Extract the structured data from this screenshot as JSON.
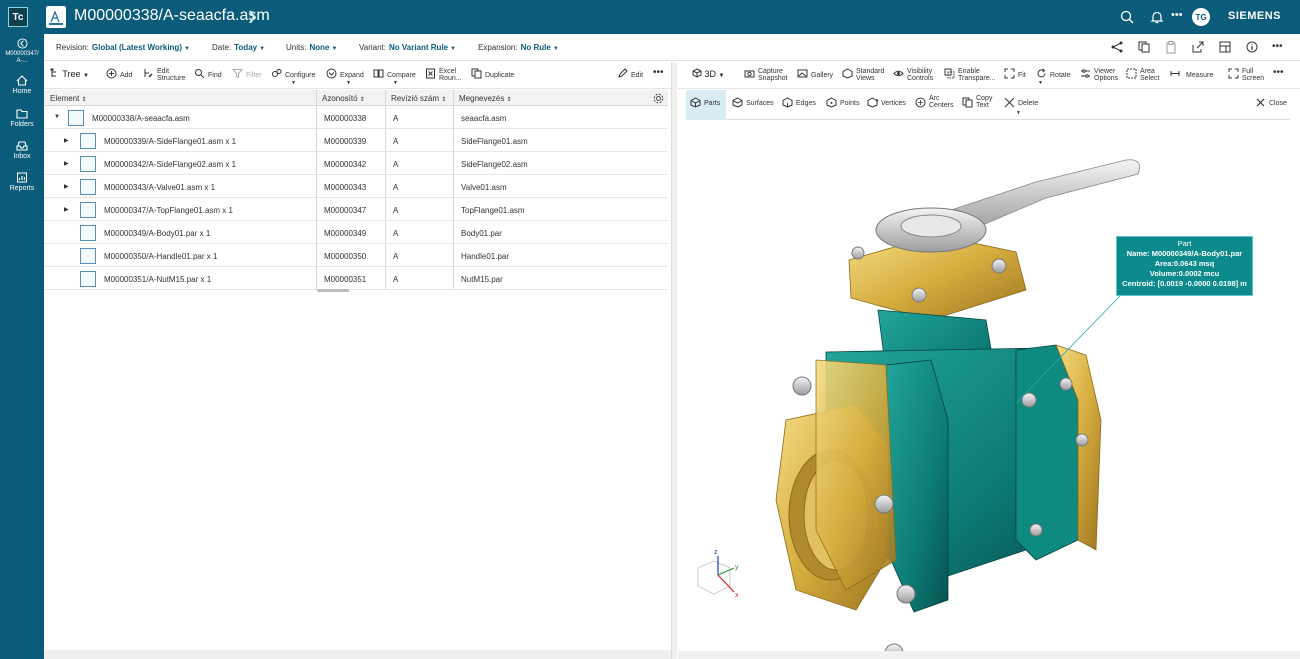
{
  "app": {
    "logo": "Tc",
    "title": "M00000338/A-seaacfa.asm",
    "brand": "SIEMENS",
    "user_initials": "TG"
  },
  "rail": {
    "items": [
      {
        "label": "M00000347/\nA-...",
        "icon": "back-icon"
      },
      {
        "label": "Home",
        "icon": "home-icon"
      },
      {
        "label": "Folders",
        "icon": "folder-icon"
      },
      {
        "label": "Inbox",
        "icon": "inbox-icon"
      },
      {
        "label": "Reports",
        "icon": "reports-icon"
      }
    ]
  },
  "context": {
    "revision_label": "Revision:",
    "revision_value": "Global (Latest Working)",
    "date_label": "Date:",
    "date_value": "Today",
    "units_label": "Units:",
    "units_value": "None",
    "variant_label": "Variant:",
    "variant_value": "No Variant Rule",
    "expansion_label": "Expansion:",
    "expansion_value": "No Rule"
  },
  "left_toolbar": {
    "tree": "Tree",
    "add": "Add",
    "edit_structure_1": "Edit",
    "edit_structure_2": "Structure",
    "find": "Find",
    "filter": "Filter",
    "configure": "Configure",
    "expand": "Expand",
    "compare": "Compare",
    "excel_1": "Excel",
    "excel_2": "Roun...",
    "duplicate": "Duplicate",
    "edit": "Edit",
    "more": "•••"
  },
  "table": {
    "headers": [
      "Element",
      "Azonosító",
      "Revízió szám",
      "Megnevezés"
    ],
    "rows": [
      {
        "element": "M00000338/A-seaacfa.asm",
        "id": "M00000338",
        "rev": "A",
        "name": "seaacfa.asm"
      },
      {
        "element": "M00000339/A-SideFlange01.asm x 1",
        "id": "M00000339",
        "rev": "A",
        "name": "SideFlange01.asm"
      },
      {
        "element": "M00000342/A-SideFlange02.asm x 1",
        "id": "M00000342",
        "rev": "A",
        "name": "SideFlange02.asm"
      },
      {
        "element": "M00000343/A-Valve01.asm x 1",
        "id": "M00000343",
        "rev": "A",
        "name": "Valve01.asm"
      },
      {
        "element": "M00000347/A-TopFlange01.asm x 1",
        "id": "M00000347",
        "rev": "A",
        "name": "TopFlange01.asm"
      },
      {
        "element": "M00000349/A-Body01.par x 1",
        "id": "M00000349",
        "rev": "A",
        "name": "Body01.par"
      },
      {
        "element": "M00000350/A-Handle01.par x 1",
        "id": "M00000350",
        "rev": "A",
        "name": "Handle01.par"
      },
      {
        "element": "M00000351/A-NutM15.par x 1",
        "id": "M00000351",
        "rev": "A",
        "name": "NutM15.par"
      }
    ]
  },
  "viewer_toolbar": {
    "mode": "3D",
    "capture_1": "Capture",
    "capture_2": "Snapshot",
    "gallery": "Gallery",
    "standard_1": "Standard",
    "standard_2": "Views",
    "visibility_1": "Visibility",
    "visibility_2": "Controls",
    "enable_1": "Enable",
    "enable_2": "Transpare...",
    "fit": "Fit",
    "rotate": "Rotate",
    "viewer_1": "Viewer",
    "viewer_2": "Options",
    "area_1": "Area",
    "area_2": "Select",
    "measure": "Measure",
    "full_1": "Full",
    "full_2": "Screen",
    "more": "•••"
  },
  "measure_toolbar": {
    "parts": "Parts",
    "surfaces": "Surfaces",
    "edges": "Edges",
    "points": "Points",
    "vertices": "Vertices",
    "arc_1": "Arc",
    "arc_2": "Centers",
    "copy_1": "Copy",
    "copy_2": "Text",
    "delete": "Delete",
    "close": "Close"
  },
  "callout": {
    "title": "Part",
    "name": "Name: M00000349/A-Body01.par",
    "area": "Area:0.0643 msq",
    "volume": "Volume:0.0002 mcu",
    "centroid": "Centroid: [0.0019 -0.0000 0.0198] m"
  },
  "colors": {
    "header": "#0b5b7a",
    "accent": "#0b5b7a",
    "callout": "#0d8a8c",
    "body_teal": "#0f7f79",
    "brass": "#d9b44a"
  }
}
